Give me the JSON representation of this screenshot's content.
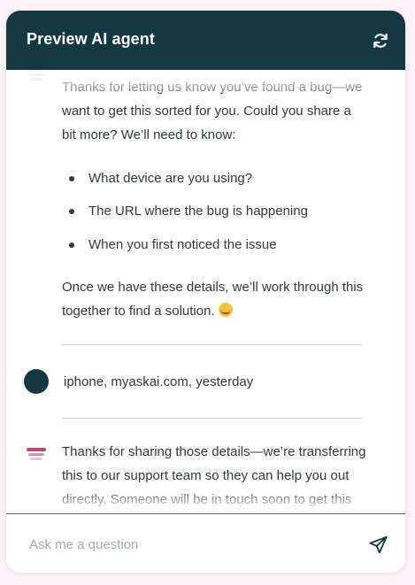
{
  "header": {
    "title": "Preview AI agent",
    "refresh_icon": "refresh-icon"
  },
  "messages": {
    "first_bot": {
      "intro": "Thanks for letting us know you’ve found a bug—we want to get this sorted for you. Could you share a bit more? We’ll need to know:",
      "bullets": [
        "What device are you using?",
        "The URL where the bug is happening",
        "When you first noticed the issue"
      ],
      "outro": "Once we have these details, we’ll work through this together to find a solution."
    },
    "user": {
      "text": "iphone, myaskai.com, yesterday"
    },
    "second_bot": {
      "text": "Thanks for sharing those details—we’re transferring this to our support team so they can help you out directly. Someone will be in touch soon to get this sorted."
    }
  },
  "composer": {
    "placeholder": "Ask me a question",
    "send_icon": "send-icon"
  },
  "colors": {
    "header_bg": "#123842",
    "page_bg": "#fdf3f8",
    "bot_icon": "#b8467e",
    "user_avatar": "#123842"
  }
}
